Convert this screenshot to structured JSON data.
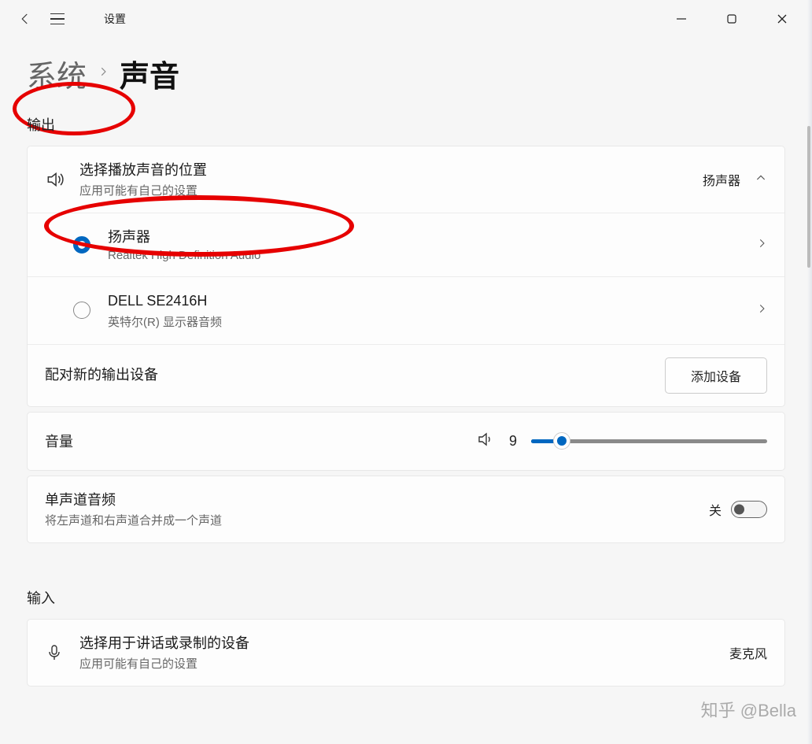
{
  "app": {
    "title": "设置"
  },
  "breadcrumb": {
    "system": "系统",
    "current": "声音"
  },
  "output": {
    "section_title": "输出",
    "select_device_title": "选择播放声音的位置",
    "select_device_subtitle": "应用可能有自己的设置",
    "current_device": "扬声器",
    "devices": [
      {
        "name": "扬声器",
        "desc": "Realtek High Definition Audio",
        "selected": true
      },
      {
        "name": "DELL SE2416H",
        "desc": "英特尔(R) 显示器音频",
        "selected": false
      }
    ],
    "pair_new_label": "配对新的输出设备",
    "add_device_label": "添加设备"
  },
  "volume": {
    "label": "音量",
    "value": "9",
    "percent": 13
  },
  "mono": {
    "title": "单声道音频",
    "subtitle": "将左声道和右声道合并成一个声道",
    "state_label": "关"
  },
  "input": {
    "section_title": "输入",
    "select_device_title": "选择用于讲话或录制的设备",
    "select_device_subtitle": "应用可能有自己的设置",
    "current_device": "麦克风"
  },
  "watermark": "知乎 @Bella"
}
